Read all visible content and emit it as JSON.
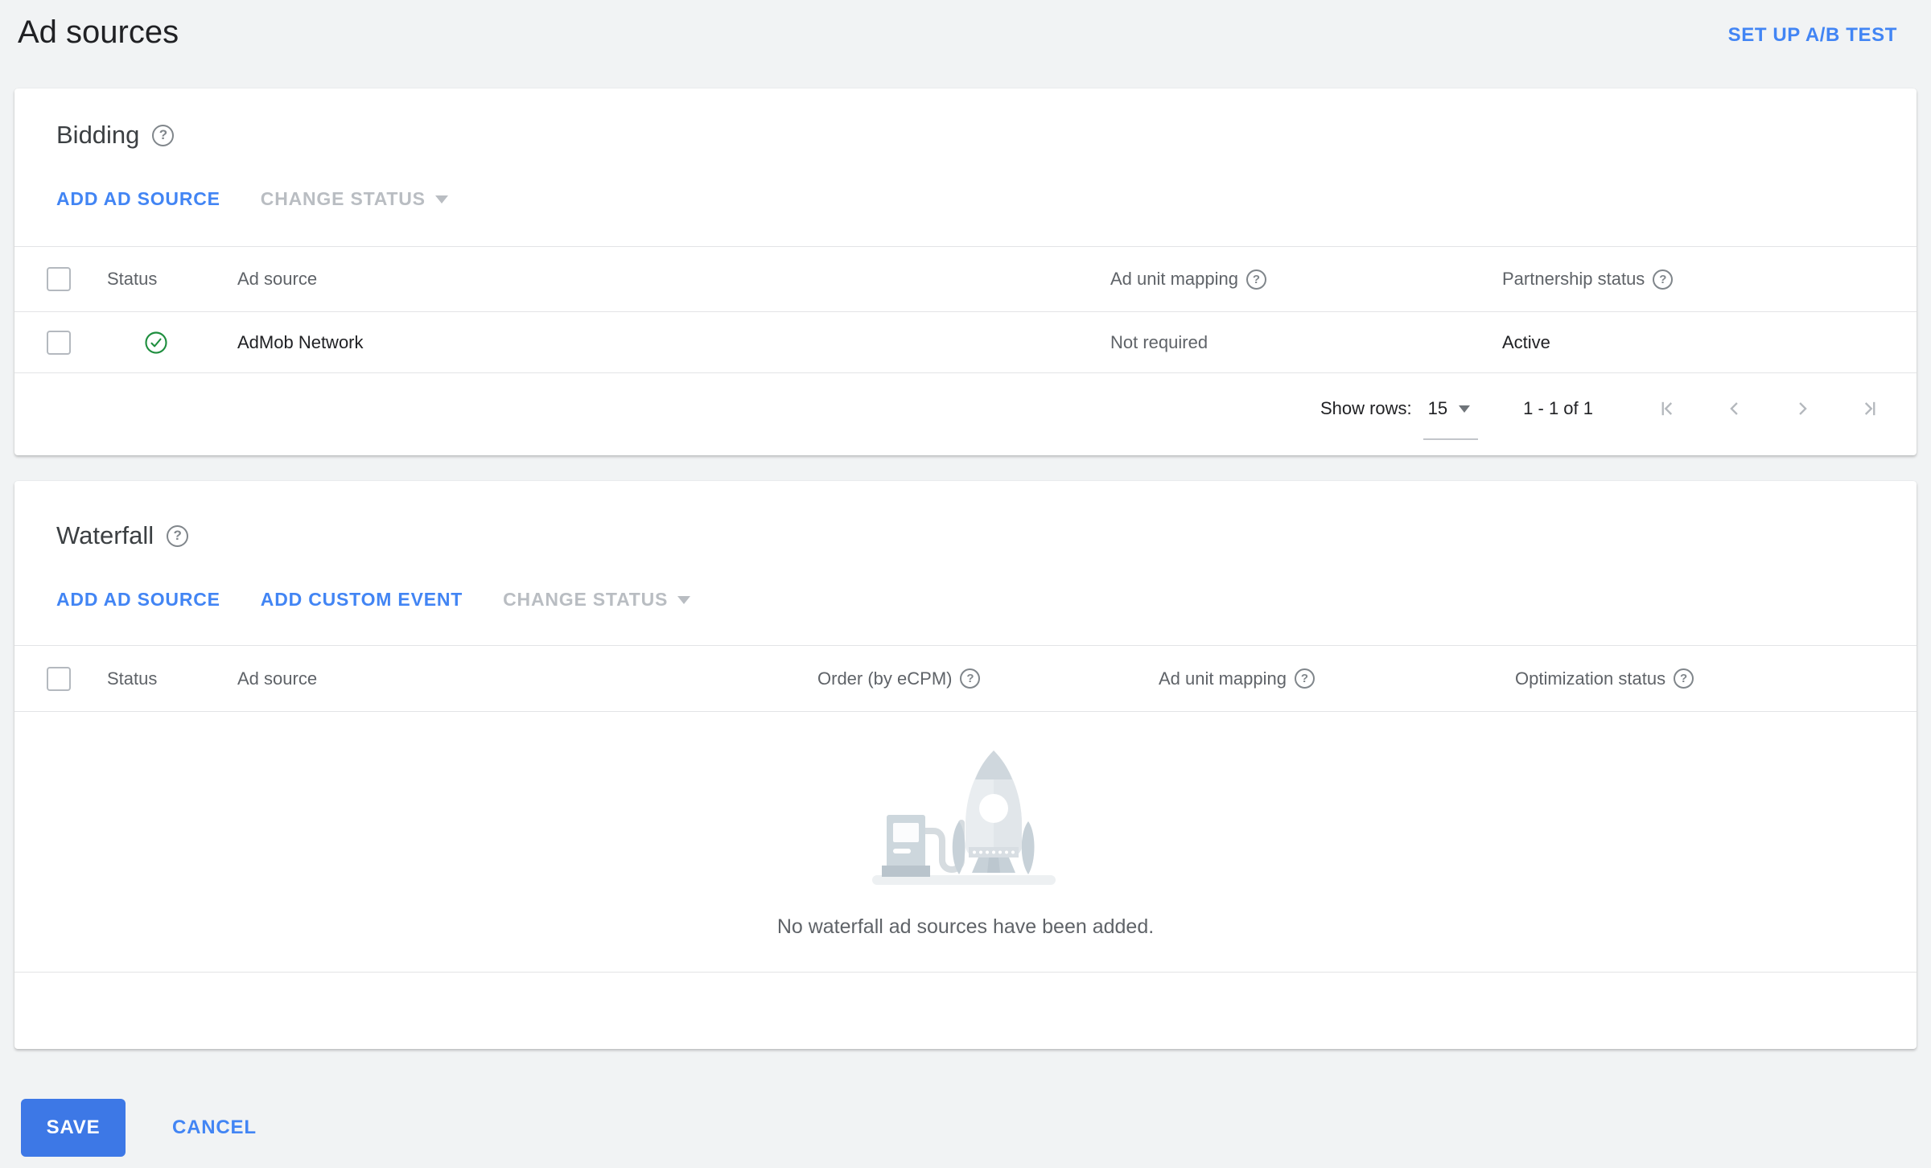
{
  "page": {
    "title": "Ad sources",
    "setup_ab_test_label": "SET UP A/B TEST"
  },
  "icons": {
    "help": "?"
  },
  "bidding": {
    "title": "Bidding",
    "add_ad_source_label": "ADD AD SOURCE",
    "change_status_label": "CHANGE STATUS",
    "table": {
      "headers": {
        "status": "Status",
        "ad_source": "Ad source",
        "ad_unit_mapping": "Ad unit mapping",
        "partnership_status": "Partnership status"
      },
      "rows": [
        {
          "status_icon": "check-circle",
          "ad_source": "AdMob Network",
          "ad_unit_mapping": "Not required",
          "partnership_status": "Active"
        }
      ]
    },
    "pagination": {
      "show_rows_label": "Show rows:",
      "rows_per_page": "15",
      "range_label": "1 - 1 of 1"
    }
  },
  "waterfall": {
    "title": "Waterfall",
    "add_ad_source_label": "ADD AD SOURCE",
    "add_custom_event_label": "ADD CUSTOM EVENT",
    "change_status_label": "CHANGE STATUS",
    "table": {
      "headers": {
        "status": "Status",
        "ad_source": "Ad source",
        "order": "Order (by eCPM)",
        "ad_unit_mapping": "Ad unit mapping",
        "optimization_status": "Optimization status"
      }
    },
    "empty_message": "No waterfall ad sources have been added."
  },
  "footer": {
    "save_label": "SAVE",
    "cancel_label": "CANCEL"
  },
  "colors": {
    "accent_blue": "#4285f4",
    "save_button_blue": "#3d78e6",
    "disabled_gray": "#b9bdc2",
    "success_green": "#1e8e3e",
    "page_background": "#f1f3f4"
  }
}
